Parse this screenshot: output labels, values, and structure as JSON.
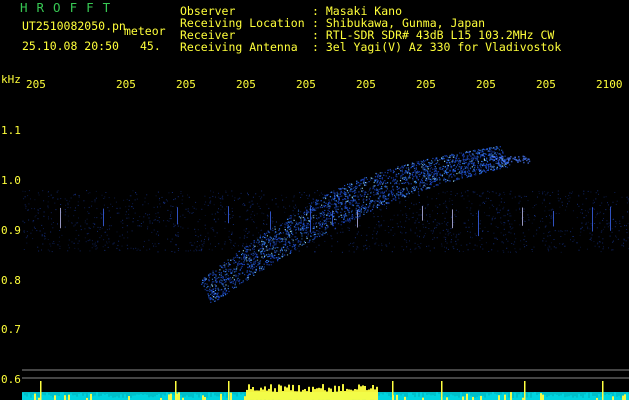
{
  "app": {
    "title": "HROFFT"
  },
  "file": {
    "name": "UT2510082050.pn",
    "tag": "meteor",
    "datetime": "25.10.08 20:50",
    "number": "45."
  },
  "info": {
    "rows": [
      {
        "label": "Observer",
        "value": ": Masaki Kano"
      },
      {
        "label": "Receiving Location",
        "value": ": Shibukawa, Gunma, Japan"
      },
      {
        "label": "Receiver",
        "value": ": RTL-SDR SDR# 43dB L15 103.2MHz CW"
      },
      {
        "label": "Receiving Antenna",
        "value": ": 3el Yagi(V) Az 330 for Vladivostok"
      }
    ]
  },
  "axes": {
    "y_unit": "kHz",
    "x_ticks": [
      "205",
      "205",
      "205",
      "205",
      "205",
      "205",
      "205",
      "205",
      "205",
      "2100"
    ],
    "y_ticks": [
      "1.1",
      "1.0",
      "0.9",
      "0.8",
      "0.7",
      "0.6"
    ]
  },
  "colors": {
    "background": "#000000",
    "label": "#ffff3a",
    "title": "#37c853",
    "signal": "#2a6bff",
    "baseline": "#00d5e0",
    "burst": "#ffff40"
  }
}
